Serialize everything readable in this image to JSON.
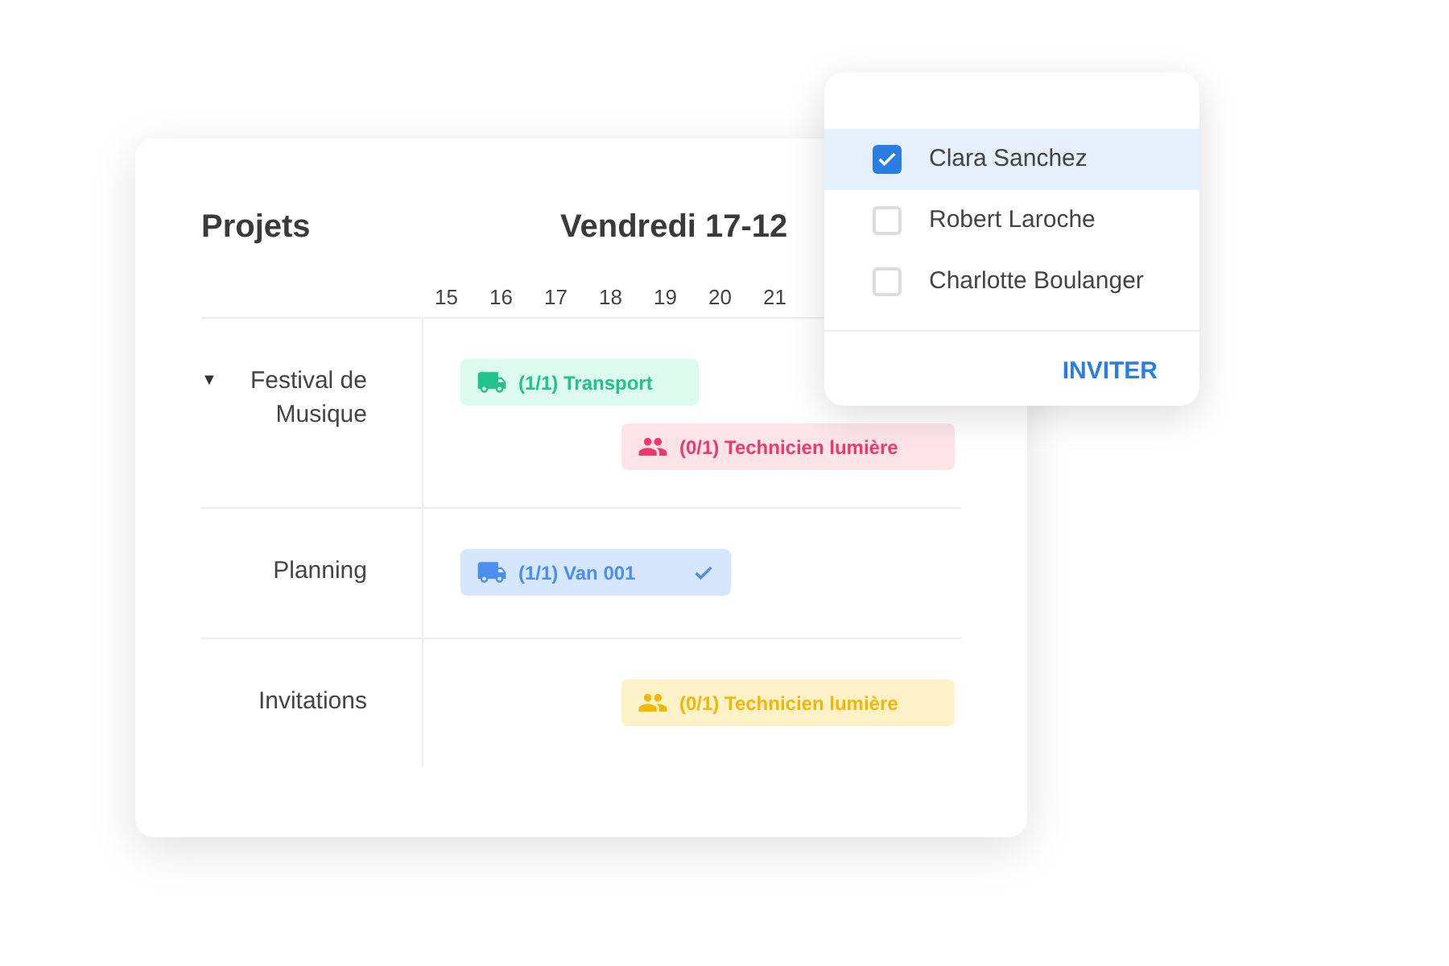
{
  "card": {
    "title": "Projets",
    "date": "Vendredi 17-12",
    "hours": [
      "15",
      "16",
      "17",
      "18",
      "19",
      "20",
      "21"
    ],
    "rows": [
      {
        "label": "Festival de Musique",
        "toggle": "▼",
        "bars": [
          {
            "kind": "truck",
            "text": "(1/1) Transport",
            "color": "#22c38a",
            "confirmed": false
          },
          {
            "kind": "people",
            "text": "(0/1) Technicien lumière",
            "color": "#f0386b",
            "confirmed": false
          }
        ]
      },
      {
        "label": "Planning",
        "bars": [
          {
            "kind": "truck",
            "text": "(1/1) Van 001",
            "color": "#4a8ff0",
            "confirmed": true
          }
        ]
      },
      {
        "label": "Invitations",
        "bars": [
          {
            "kind": "people",
            "text": "(0/1) Technicien lumière",
            "color": "#f2b705",
            "confirmed": false
          }
        ]
      }
    ]
  },
  "popup": {
    "people": [
      {
        "name": "Clara Sanchez",
        "checked": true
      },
      {
        "name": "Robert Laroche",
        "checked": false
      },
      {
        "name": "Charlotte Boulanger",
        "checked": false
      }
    ],
    "button": "INVITER"
  }
}
